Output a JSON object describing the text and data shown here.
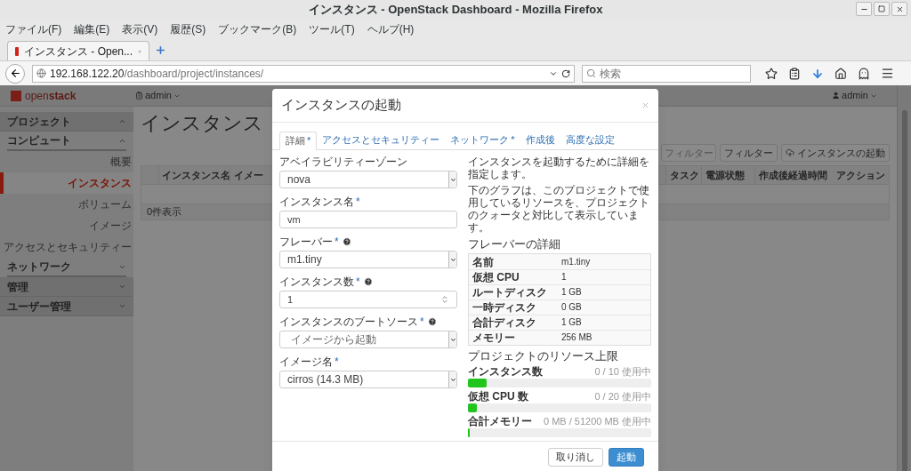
{
  "window": {
    "title": "インスタンス - OpenStack Dashboard - Mozilla Firefox"
  },
  "menu": [
    "ファイル(F)",
    "編集(E)",
    "表示(V)",
    "履歴(S)",
    "ブックマーク(B)",
    "ツール(T)",
    "ヘルプ(H)"
  ],
  "browser_tab": {
    "title": "インスタンス - Open..."
  },
  "address_bar": {
    "host": "192.168.122.20",
    "path": "/dashboard/project/instances/"
  },
  "search": {
    "placeholder": "検索"
  },
  "app": {
    "brand_light": "open",
    "brand_bold": "stack",
    "project_menu": "admin",
    "user_menu": "admin"
  },
  "sidebar": [
    {
      "label": "プロジェクト",
      "expanded": true,
      "children": [
        {
          "label": "コンピュート",
          "expanded": true,
          "children": [
            {
              "label": "概要",
              "selected": false
            },
            {
              "label": "インスタンス",
              "selected": true
            },
            {
              "label": "ボリューム",
              "selected": false
            },
            {
              "label": "イメージ",
              "selected": false
            },
            {
              "label": "アクセスとセキュリティー",
              "selected": false
            }
          ]
        },
        {
          "label": "ネットワーク",
          "expanded": false
        }
      ]
    },
    {
      "label": "管理",
      "expanded": false
    },
    {
      "label": "ユーザー管理",
      "expanded": false
    }
  ],
  "page": {
    "title": "インスタンス",
    "filter_placeholder": "フィルター",
    "filter_button": "フィルター",
    "launch_button": "インスタンスの起動",
    "table": {
      "left_columns": [
        "インスタンス名",
        "イメー"
      ],
      "right_columns": [
        "タスク",
        "電源状態",
        "作成後経過時間",
        "アクション"
      ],
      "footer": "0件表示"
    }
  },
  "modal": {
    "title": "インスタンスの起動",
    "tabs": [
      {
        "label": "詳細",
        "mark": "*",
        "selected": true
      },
      {
        "label": "アクセスとセキュリティー",
        "selected": false
      },
      {
        "label": "ネットワーク",
        "mark": "*",
        "selected": false
      },
      {
        "label": "作成後",
        "selected": false
      },
      {
        "label": "高度な設定",
        "selected": false
      }
    ],
    "fields": [
      {
        "kind": "select",
        "label": "アベイラビリティーゾーン",
        "value": "nova"
      },
      {
        "kind": "text",
        "label": "インスタンス名",
        "mark": "*",
        "value": "vm"
      },
      {
        "kind": "select",
        "label": "フレーバー",
        "mark": "*",
        "help": true,
        "value": "m1.tiny"
      },
      {
        "kind": "number",
        "label": "インスタンス数",
        "mark": "*",
        "help": true,
        "value": "1"
      },
      {
        "kind": "select",
        "label": "インスタンスのブートソース",
        "mark": "*",
        "help": true,
        "placeholder": "イメージから起動"
      },
      {
        "kind": "select",
        "label": "イメージ名",
        "mark": "*",
        "value": "cirros (14.3 MB)"
      }
    ],
    "description": [
      "インスタンスを起動するために詳細を指定します。",
      "下のグラフは、このプロジェクトで使用しているリソースを、プロジェクトのクォータと対比して表示しています。"
    ],
    "flavor": {
      "title": "フレーバーの詳細",
      "rows": [
        {
          "name": "名前",
          "value": "m1.tiny"
        },
        {
          "name": "仮想 CPU",
          "value": "1"
        },
        {
          "name": "ルートディスク",
          "value": "1 GB"
        },
        {
          "name": "一時ディスク",
          "value": "0 GB"
        },
        {
          "name": "合計ディスク",
          "value": "1 GB"
        },
        {
          "name": "メモリー",
          "value": "256 MB"
        }
      ]
    },
    "limits": {
      "title": "プロジェクトのリソース上限",
      "bars": [
        {
          "label": "インスタンス数",
          "reading": "0 / 10 使用中",
          "level": 0.1
        },
        {
          "label": "仮想 CPU 数",
          "reading": "0 / 20 使用中",
          "level": 0.05
        },
        {
          "label": "合計メモリー",
          "reading": "0 MB / 51200 MB 使用中",
          "level": 0.01
        }
      ]
    },
    "buttons": [
      {
        "kind": "cancel",
        "label": "取り消し"
      },
      {
        "kind": "primary",
        "label": "起動"
      }
    ]
  }
}
